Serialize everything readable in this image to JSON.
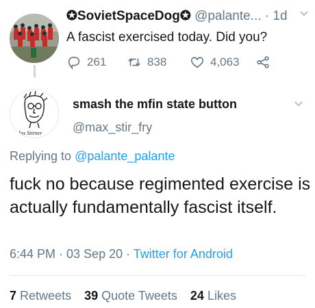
{
  "parent_tweet": {
    "display_name": "✪SovietSpaceDog✪",
    "handle": "@palante...",
    "time": "· 1d",
    "text": "A fascist exercised today. Did you?",
    "replies": "261",
    "retweets": "838",
    "likes": "4,063"
  },
  "tweet": {
    "display_name": "smash the mfin state button",
    "handle": "@max_stir_fry",
    "replying_prefix": "Replying to",
    "replying_handle": "@palante_palante",
    "text": "fuck no because regimented exercise is actually fundamentally fascist itself.",
    "timestamp": "6:44 PM · 03 Sep 20 ·",
    "source": "Twitter for Android",
    "avatar_signature": "Max Stirner"
  },
  "stats": {
    "retweets_count": "7",
    "retweets_label": "Retweets",
    "quotes_count": "39",
    "quotes_label": "Quote Tweets",
    "likes_count": "24",
    "likes_label": "Likes"
  },
  "colors": {
    "link": "#1da1f2",
    "secondary_text": "#657786",
    "primary_text": "#14171a"
  }
}
